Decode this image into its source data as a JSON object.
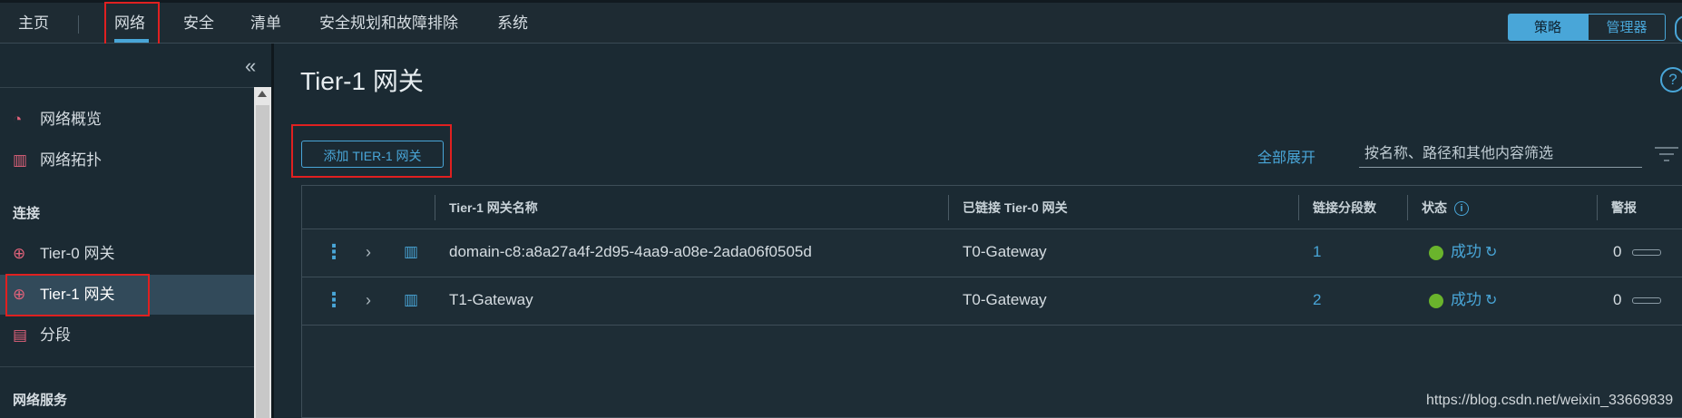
{
  "nav": {
    "items": [
      "主页",
      "网络",
      "安全",
      "清单",
      "安全规划和故障排除",
      "系统"
    ],
    "active": "网络",
    "mode_policy": "策略",
    "mode_manager": "管理器"
  },
  "sidebar": {
    "items_top": [
      {
        "label": "网络概览",
        "icon": "gauge-icon"
      },
      {
        "label": "网络拓扑",
        "icon": "map-icon"
      }
    ],
    "section_connect": "连接",
    "items_connect": [
      {
        "label": "Tier-0 网关",
        "icon": "gateway-icon"
      },
      {
        "label": "Tier-1 网关",
        "icon": "gateway-icon",
        "active": true
      },
      {
        "label": "分段",
        "icon": "segment-icon"
      }
    ],
    "section_services": "网络服务"
  },
  "page": {
    "title": "Tier-1 网关",
    "add_button": "添加 TIER-1 网关",
    "expand_all": "全部展开",
    "filter_placeholder": "按名称、路径和其他内容筛选"
  },
  "table": {
    "columns": [
      "Tier-1 网关名称",
      "已链接 Tier-0 网关",
      "链接分段数",
      "状态",
      "警报"
    ],
    "rows": [
      {
        "name": "domain-c8:a8a27a4f-2d95-4aa9-a08e-2ada06f0505d",
        "tier0": "T0-Gateway",
        "segments": "1",
        "status": "成功",
        "alarms": "0"
      },
      {
        "name": "T1-Gateway",
        "tier0": "T0-Gateway",
        "segments": "2",
        "status": "成功",
        "alarms": "0"
      }
    ]
  },
  "watermark": "https://blog.csdn.net/weixin_33669839",
  "colors": {
    "accent": "#49a6d8",
    "success": "#6ab42c",
    "highlight": "#e02020"
  }
}
